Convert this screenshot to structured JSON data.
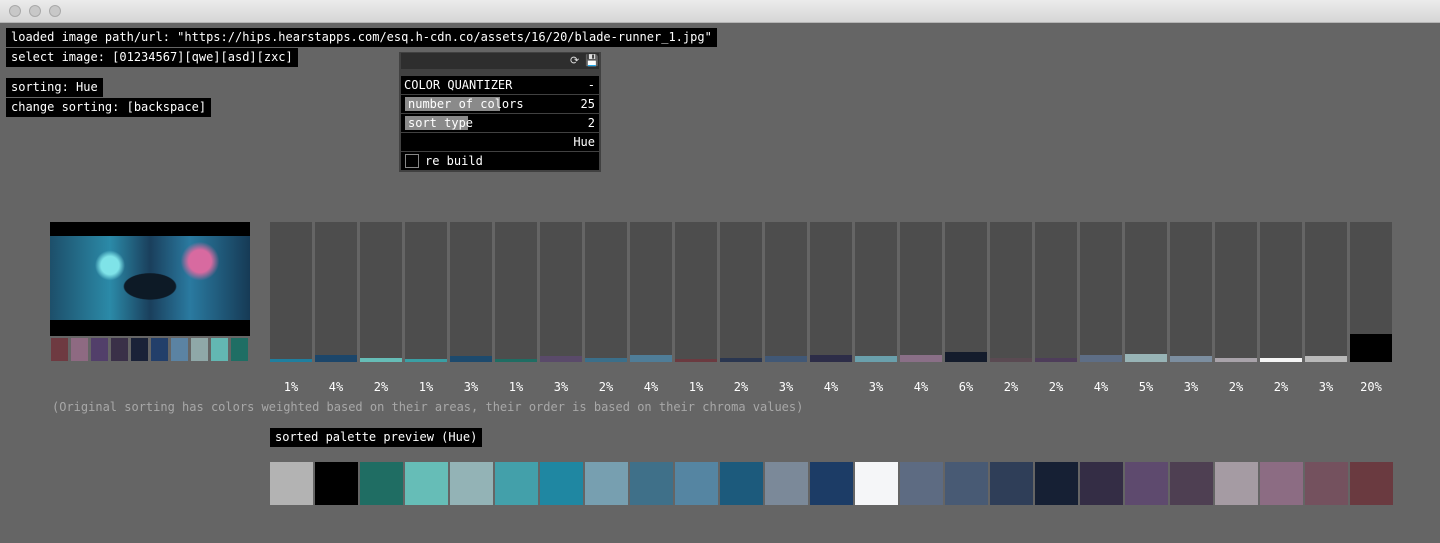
{
  "header": {
    "loaded_path": "loaded image path/url: \"https://hips.hearstapps.com/esq.h-cdn.co/assets/16/20/blade-runner_1.jpg\"",
    "select_image": "select image: [01234567][qwe][asd][zxc]",
    "sorting": "sorting: Hue",
    "change_sorting": "change sorting: [backspace]"
  },
  "panel": {
    "refresh_icon": "⟳",
    "save_icon": "💾",
    "title": "COLOR QUANTIZER",
    "collapse": "-",
    "num_colors_label": "number of colors",
    "num_colors_value": "25",
    "num_colors_fraction": 0.5,
    "sort_type_label": "sort type",
    "sort_type_value": "2",
    "sort_type_fraction": 0.33,
    "sort_name": "Hue",
    "rebuild_label": "re build"
  },
  "thumb_swatches": [
    "#6e3a41",
    "#8e6a82",
    "#523f6a",
    "#3a3048",
    "#1a2238",
    "#233f6a",
    "#5b83a3",
    "#8fa8a8",
    "#63b7b2",
    "#1f6e64"
  ],
  "bars": [
    {
      "pct": "1%",
      "color": "#1f7f9f",
      "level": 0.02
    },
    {
      "pct": "4%",
      "color": "#1c466a",
      "level": 0.05
    },
    {
      "pct": "2%",
      "color": "#66bdb7",
      "level": 0.03
    },
    {
      "pct": "1%",
      "color": "#3a9fa4",
      "level": 0.02
    },
    {
      "pct": "3%",
      "color": "#1d4a6d",
      "level": 0.04
    },
    {
      "pct": "1%",
      "color": "#1f6d63",
      "level": 0.02
    },
    {
      "pct": "3%",
      "color": "#5a4a6a",
      "level": 0.04
    },
    {
      "pct": "2%",
      "color": "#3b6f8a",
      "level": 0.03
    },
    {
      "pct": "4%",
      "color": "#4f7d98",
      "level": 0.05
    },
    {
      "pct": "1%",
      "color": "#6b3a40",
      "level": 0.02
    },
    {
      "pct": "2%",
      "color": "#2a3650",
      "level": 0.03
    },
    {
      "pct": "3%",
      "color": "#415876",
      "level": 0.04
    },
    {
      "pct": "4%",
      "color": "#2d2d48",
      "level": 0.05
    },
    {
      "pct": "3%",
      "color": "#6aa0ac",
      "level": 0.04
    },
    {
      "pct": "4%",
      "color": "#8a6f87",
      "level": 0.05
    },
    {
      "pct": "6%",
      "color": "#141c2c",
      "level": 0.07
    },
    {
      "pct": "2%",
      "color": "#5a4a52",
      "level": 0.03
    },
    {
      "pct": "2%",
      "color": "#4e3d5a",
      "level": 0.03
    },
    {
      "pct": "4%",
      "color": "#5e6e86",
      "level": 0.05
    },
    {
      "pct": "5%",
      "color": "#98b4b6",
      "level": 0.06
    },
    {
      "pct": "3%",
      "color": "#7c8ea0",
      "level": 0.04
    },
    {
      "pct": "2%",
      "color": "#a9a3aa",
      "level": 0.03
    },
    {
      "pct": "2%",
      "color": "#f5f5f5",
      "level": 0.03
    },
    {
      "pct": "3%",
      "color": "#b9b9b9",
      "level": 0.04
    },
    {
      "pct": "20%",
      "color": "#000000",
      "level": 0.2
    }
  ],
  "note": "(Original sorting has colors weighted based on their areas, their order is based on their chroma values)",
  "preview_label": "sorted palette preview (Hue)",
  "palette": [
    "#b3b3b3",
    "#000000",
    "#1f6d63",
    "#66bdb7",
    "#93b3b6",
    "#43a0aa",
    "#1f87a2",
    "#779fb0",
    "#3f7089",
    "#5585a2",
    "#1c5a7c",
    "#7b8999",
    "#1c3c66",
    "#f5f6f8",
    "#5d6b82",
    "#485a74",
    "#2f3e58",
    "#162034",
    "#342d45",
    "#5e4a6e",
    "#4e3f52",
    "#a59ba3",
    "#8c6c83",
    "#74515e",
    "#6a3a40"
  ]
}
